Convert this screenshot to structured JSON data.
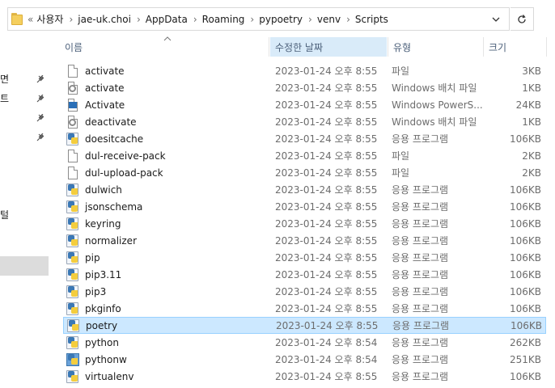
{
  "address": {
    "overflow": "«",
    "crumbs": [
      "사용자",
      "jae-uk.choi",
      "AppData",
      "Roaming",
      "pypoetry",
      "venv",
      "Scripts"
    ]
  },
  "nav": {
    "items": [
      {
        "label": "면",
        "pinned": true
      },
      {
        "label": "트",
        "pinned": true
      },
      {
        "label": "",
        "pinned": true
      },
      {
        "label": "",
        "pinned": true
      },
      {
        "label": "털",
        "pinned": false
      }
    ]
  },
  "columns": {
    "name": "이름",
    "date": "수정한 날짜",
    "type": "유형",
    "size": "크기"
  },
  "files": [
    {
      "name": "activate",
      "date": "2023-01-24 오후 8:55",
      "type": "파일",
      "size": "3KB",
      "icon": "file-icon"
    },
    {
      "name": "activate",
      "date": "2023-01-24 오후 8:55",
      "type": "Windows 배치 파일",
      "size": "1KB",
      "icon": "batch-file-icon"
    },
    {
      "name": "Activate",
      "date": "2023-01-24 오후 8:55",
      "type": "Windows PowerS...",
      "size": "24KB",
      "icon": "powershell-icon"
    },
    {
      "name": "deactivate",
      "date": "2023-01-24 오후 8:55",
      "type": "Windows 배치 파일",
      "size": "1KB",
      "icon": "batch-file-icon"
    },
    {
      "name": "doesitcache",
      "date": "2023-01-24 오후 8:55",
      "type": "응용 프로그램",
      "size": "106KB",
      "icon": "python-app-icon"
    },
    {
      "name": "dul-receive-pack",
      "date": "2023-01-24 오후 8:55",
      "type": "파일",
      "size": "2KB",
      "icon": "file-icon"
    },
    {
      "name": "dul-upload-pack",
      "date": "2023-01-24 오후 8:55",
      "type": "파일",
      "size": "2KB",
      "icon": "file-icon"
    },
    {
      "name": "dulwich",
      "date": "2023-01-24 오후 8:55",
      "type": "응용 프로그램",
      "size": "106KB",
      "icon": "python-app-icon"
    },
    {
      "name": "jsonschema",
      "date": "2023-01-24 오후 8:55",
      "type": "응용 프로그램",
      "size": "106KB",
      "icon": "python-app-icon"
    },
    {
      "name": "keyring",
      "date": "2023-01-24 오후 8:55",
      "type": "응용 프로그램",
      "size": "106KB",
      "icon": "python-app-icon"
    },
    {
      "name": "normalizer",
      "date": "2023-01-24 오후 8:55",
      "type": "응용 프로그램",
      "size": "106KB",
      "icon": "python-app-icon"
    },
    {
      "name": "pip",
      "date": "2023-01-24 오후 8:55",
      "type": "응용 프로그램",
      "size": "106KB",
      "icon": "python-app-icon"
    },
    {
      "name": "pip3.11",
      "date": "2023-01-24 오후 8:55",
      "type": "응용 프로그램",
      "size": "106KB",
      "icon": "python-app-icon"
    },
    {
      "name": "pip3",
      "date": "2023-01-24 오후 8:55",
      "type": "응용 프로그램",
      "size": "106KB",
      "icon": "python-app-icon"
    },
    {
      "name": "pkginfo",
      "date": "2023-01-24 오후 8:55",
      "type": "응용 프로그램",
      "size": "106KB",
      "icon": "python-app-icon"
    },
    {
      "name": "poetry",
      "date": "2023-01-24 오후 8:55",
      "type": "응용 프로그램",
      "size": "106KB",
      "icon": "python-app-icon",
      "selected": true
    },
    {
      "name": "python",
      "date": "2023-01-24 오후 8:54",
      "type": "응용 프로그램",
      "size": "262KB",
      "icon": "python-exe-icon"
    },
    {
      "name": "pythonw",
      "date": "2023-01-24 오후 8:54",
      "type": "응용 프로그램",
      "size": "251KB",
      "icon": "pythonw-exe-icon"
    },
    {
      "name": "virtualenv",
      "date": "2023-01-24 오후 8:55",
      "type": "응용 프로그램",
      "size": "106KB",
      "icon": "python-app-icon"
    }
  ],
  "colors": {
    "selection_bg": "#cce8ff",
    "selection_border": "#99d1ff",
    "sorted_header_bg": "#d9ebf9",
    "header_text": "#4c607a"
  }
}
